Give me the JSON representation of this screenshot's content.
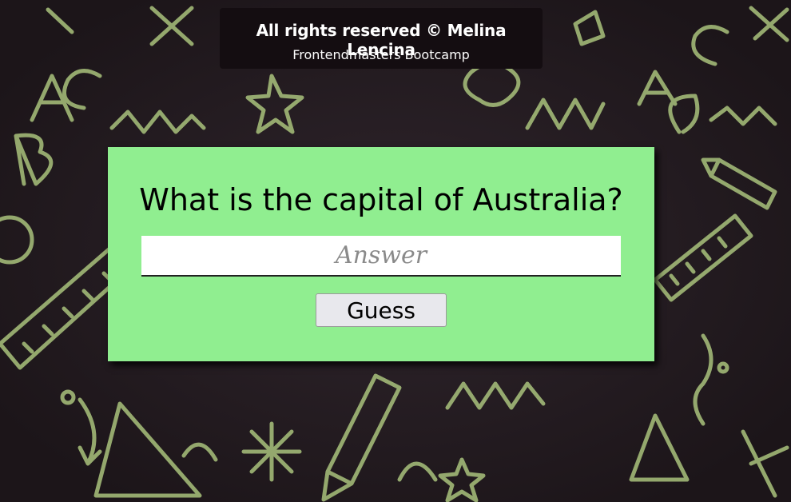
{
  "footer": {
    "copyright": "All rights reserved © Melina Lencina",
    "subtitle": "Frontendmasters Bootcamp"
  },
  "quiz": {
    "question": "What is the capital of Australia?",
    "answer_placeholder": "Answer",
    "answer_value": "",
    "guess_label": "Guess"
  },
  "colors": {
    "card_background": "#90ee90",
    "page_background": "#241c22",
    "doodle_color": "#a9c27c",
    "credit_background": "#140d11"
  }
}
